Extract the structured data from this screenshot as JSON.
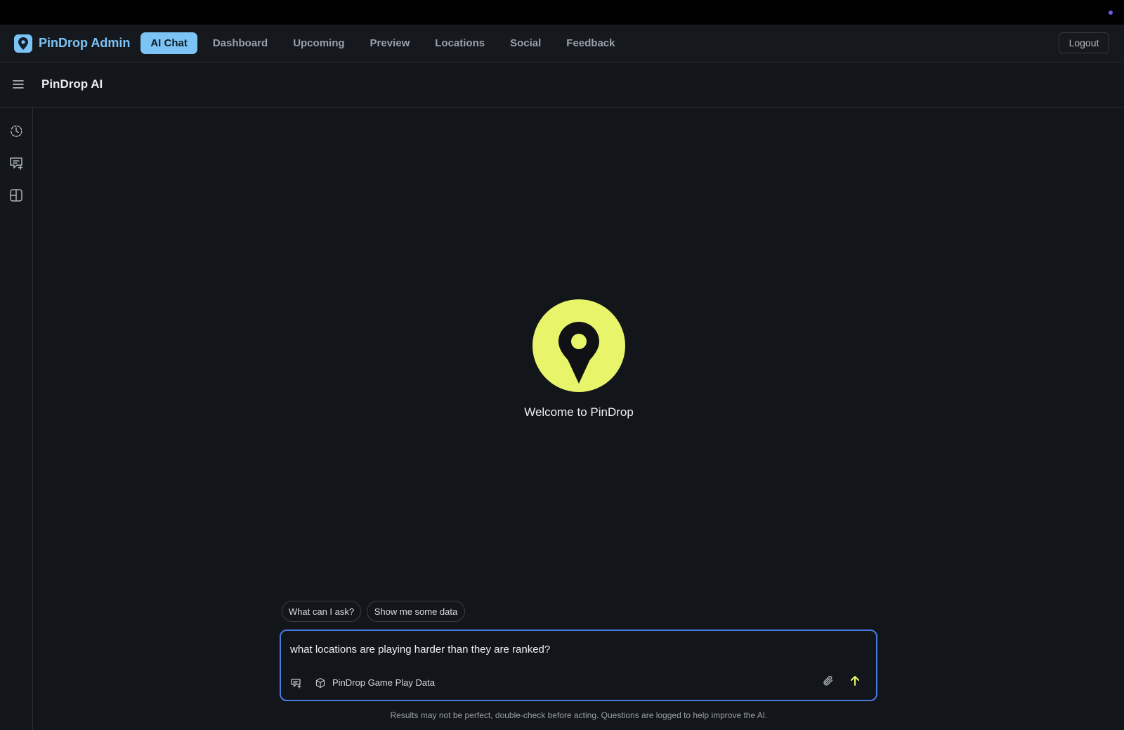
{
  "app": {
    "brand": "PinDrop Admin",
    "brand_icon": "map-pin-icon",
    "accent_color": "#7cc4f5"
  },
  "nav": {
    "items": [
      {
        "label": "AI Chat",
        "active": true
      },
      {
        "label": "Dashboard",
        "active": false
      },
      {
        "label": "Upcoming",
        "active": false
      },
      {
        "label": "Preview",
        "active": false
      },
      {
        "label": "Locations",
        "active": false
      },
      {
        "label": "Social",
        "active": false
      },
      {
        "label": "Feedback",
        "active": false
      }
    ],
    "logout_label": "Logout"
  },
  "subheader": {
    "title": "PinDrop AI",
    "menu_icon": "hamburger-menu-icon"
  },
  "sidebar": {
    "icons": [
      "history-icon",
      "new-chat-icon",
      "layout-icon"
    ]
  },
  "welcome": {
    "text": "Welcome to PinDrop",
    "logo_icon": "map-pin-icon",
    "logo_color": "#e8f56a"
  },
  "suggestions": [
    "What can I ask?",
    "Show me some data"
  ],
  "chat": {
    "input_value": "what locations are playing harder than they are ranked?",
    "data_source": "PinDrop Game Play Data",
    "focus_color": "#4a79e0",
    "send_color": "#e8f56a"
  },
  "disclaimer": "Results may not be perfect, double-check before acting. Questions are logged to help improve the AI."
}
